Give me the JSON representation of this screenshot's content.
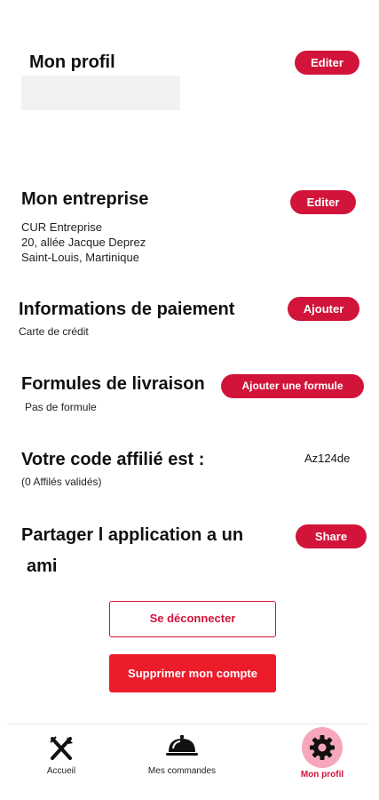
{
  "profile": {
    "title": "Mon profil",
    "edit_label": "Editer"
  },
  "company": {
    "title": "Mon entreprise",
    "edit_label": "Editer",
    "name": "CUR Entreprise",
    "address_line1": "20, allée Jacque Deprez",
    "address_line2": "Saint-Louis, Martinique"
  },
  "payment": {
    "title": "Informations de paiement",
    "add_label": "Ajouter",
    "method": "Carte de crédit"
  },
  "delivery": {
    "title": "Formules de livraison",
    "add_label": "Ajouter une formule",
    "empty_text": "Pas de formule"
  },
  "affiliate": {
    "title": "Votre code affilié est :",
    "code": "Az124de",
    "validated": "(0 Affilés validés)"
  },
  "share": {
    "title_line1": "Partager l application a un",
    "title_line2": "ami",
    "button_label": "Share"
  },
  "actions": {
    "logout_label": "Se déconnecter",
    "delete_label": "Supprimer mon compte"
  },
  "bottom_nav": {
    "items": [
      {
        "label": "Accueil",
        "icon": "fork-knife-icon"
      },
      {
        "label": "Mes commandes",
        "icon": "cloche-icon"
      },
      {
        "label": "Mon profil",
        "icon": "gear-icon",
        "active": true
      }
    ]
  },
  "colors": {
    "accent": "#d2143a",
    "danger": "#ec1c2a",
    "active_bg": "#f7a7bb"
  }
}
